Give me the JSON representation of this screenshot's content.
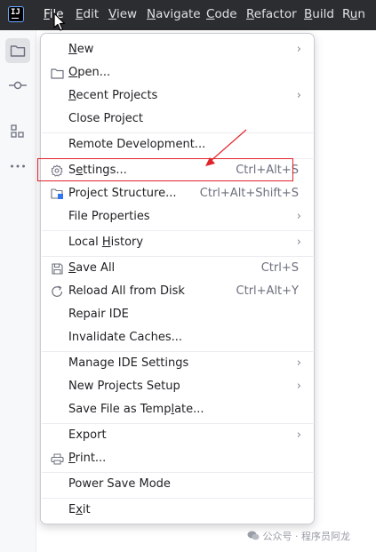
{
  "menubar": {
    "items": [
      {
        "label": "File",
        "mnemonic": "F"
      },
      {
        "label": "Edit",
        "mnemonic": "E"
      },
      {
        "label": "View",
        "mnemonic": "V"
      },
      {
        "label": "Navigate",
        "mnemonic": "N"
      },
      {
        "label": "Code",
        "mnemonic": "C"
      },
      {
        "label": "Refactor",
        "mnemonic": "R"
      },
      {
        "label": "Build",
        "mnemonic": "B"
      },
      {
        "label": "Run",
        "mnemonic": "u"
      }
    ],
    "active": "File",
    "logo_text": "IJ"
  },
  "toolstrip": {
    "items": [
      {
        "icon": "folder-icon"
      },
      {
        "icon": "commit-icon"
      },
      {
        "icon": "structure-icon"
      },
      {
        "icon": "more-icon"
      }
    ]
  },
  "file_menu": {
    "items": [
      {
        "label": "New",
        "icon": "",
        "shortcut": "",
        "submenu": true
      },
      {
        "label": "Open...",
        "icon": "folder-icon",
        "shortcut": "",
        "submenu": false
      },
      {
        "label": "Recent Projects",
        "icon": "",
        "shortcut": "",
        "submenu": true
      },
      {
        "label": "Close Project",
        "icon": "",
        "shortcut": "",
        "submenu": false
      },
      {
        "label": "Remote Development...",
        "icon": "",
        "shortcut": "",
        "submenu": false
      },
      {
        "label": "Settings...",
        "icon": "gear-icon",
        "shortcut": "Ctrl+Alt+S",
        "submenu": false
      },
      {
        "label": "Project Structure...",
        "icon": "project-structure-icon",
        "shortcut": "Ctrl+Alt+Shift+S",
        "submenu": false
      },
      {
        "label": "File Properties",
        "icon": "",
        "shortcut": "",
        "submenu": true
      },
      {
        "label": "Local History",
        "icon": "",
        "shortcut": "",
        "submenu": true
      },
      {
        "label": "Save All",
        "icon": "save-icon",
        "shortcut": "Ctrl+S",
        "submenu": false
      },
      {
        "label": "Reload All from Disk",
        "icon": "reload-icon",
        "shortcut": "Ctrl+Alt+Y",
        "submenu": false
      },
      {
        "label": "Repair IDE",
        "icon": "",
        "shortcut": "",
        "submenu": false
      },
      {
        "label": "Invalidate Caches...",
        "icon": "",
        "shortcut": "",
        "submenu": false
      },
      {
        "label": "Manage IDE Settings",
        "icon": "",
        "shortcut": "",
        "submenu": true
      },
      {
        "label": "New Projects Setup",
        "icon": "",
        "shortcut": "",
        "submenu": true
      },
      {
        "label": "Save File as Template...",
        "icon": "",
        "shortcut": "",
        "submenu": false
      },
      {
        "label": "Export",
        "icon": "",
        "shortcut": "",
        "submenu": true
      },
      {
        "label": "Print...",
        "icon": "print-icon",
        "shortcut": "",
        "submenu": false
      },
      {
        "label": "Power Save Mode",
        "icon": "",
        "shortcut": "",
        "submenu": false
      },
      {
        "label": "Exit",
        "icon": "",
        "shortcut": "",
        "submenu": false
      }
    ],
    "highlighted": "Settings..."
  },
  "watermark": "公众号 · 程序员阿龙",
  "colors": {
    "menubar_bg": "#2b2d30",
    "highlight": "#e0242b",
    "menu_bg": "#ffffff",
    "shortcut": "#6c707e"
  }
}
